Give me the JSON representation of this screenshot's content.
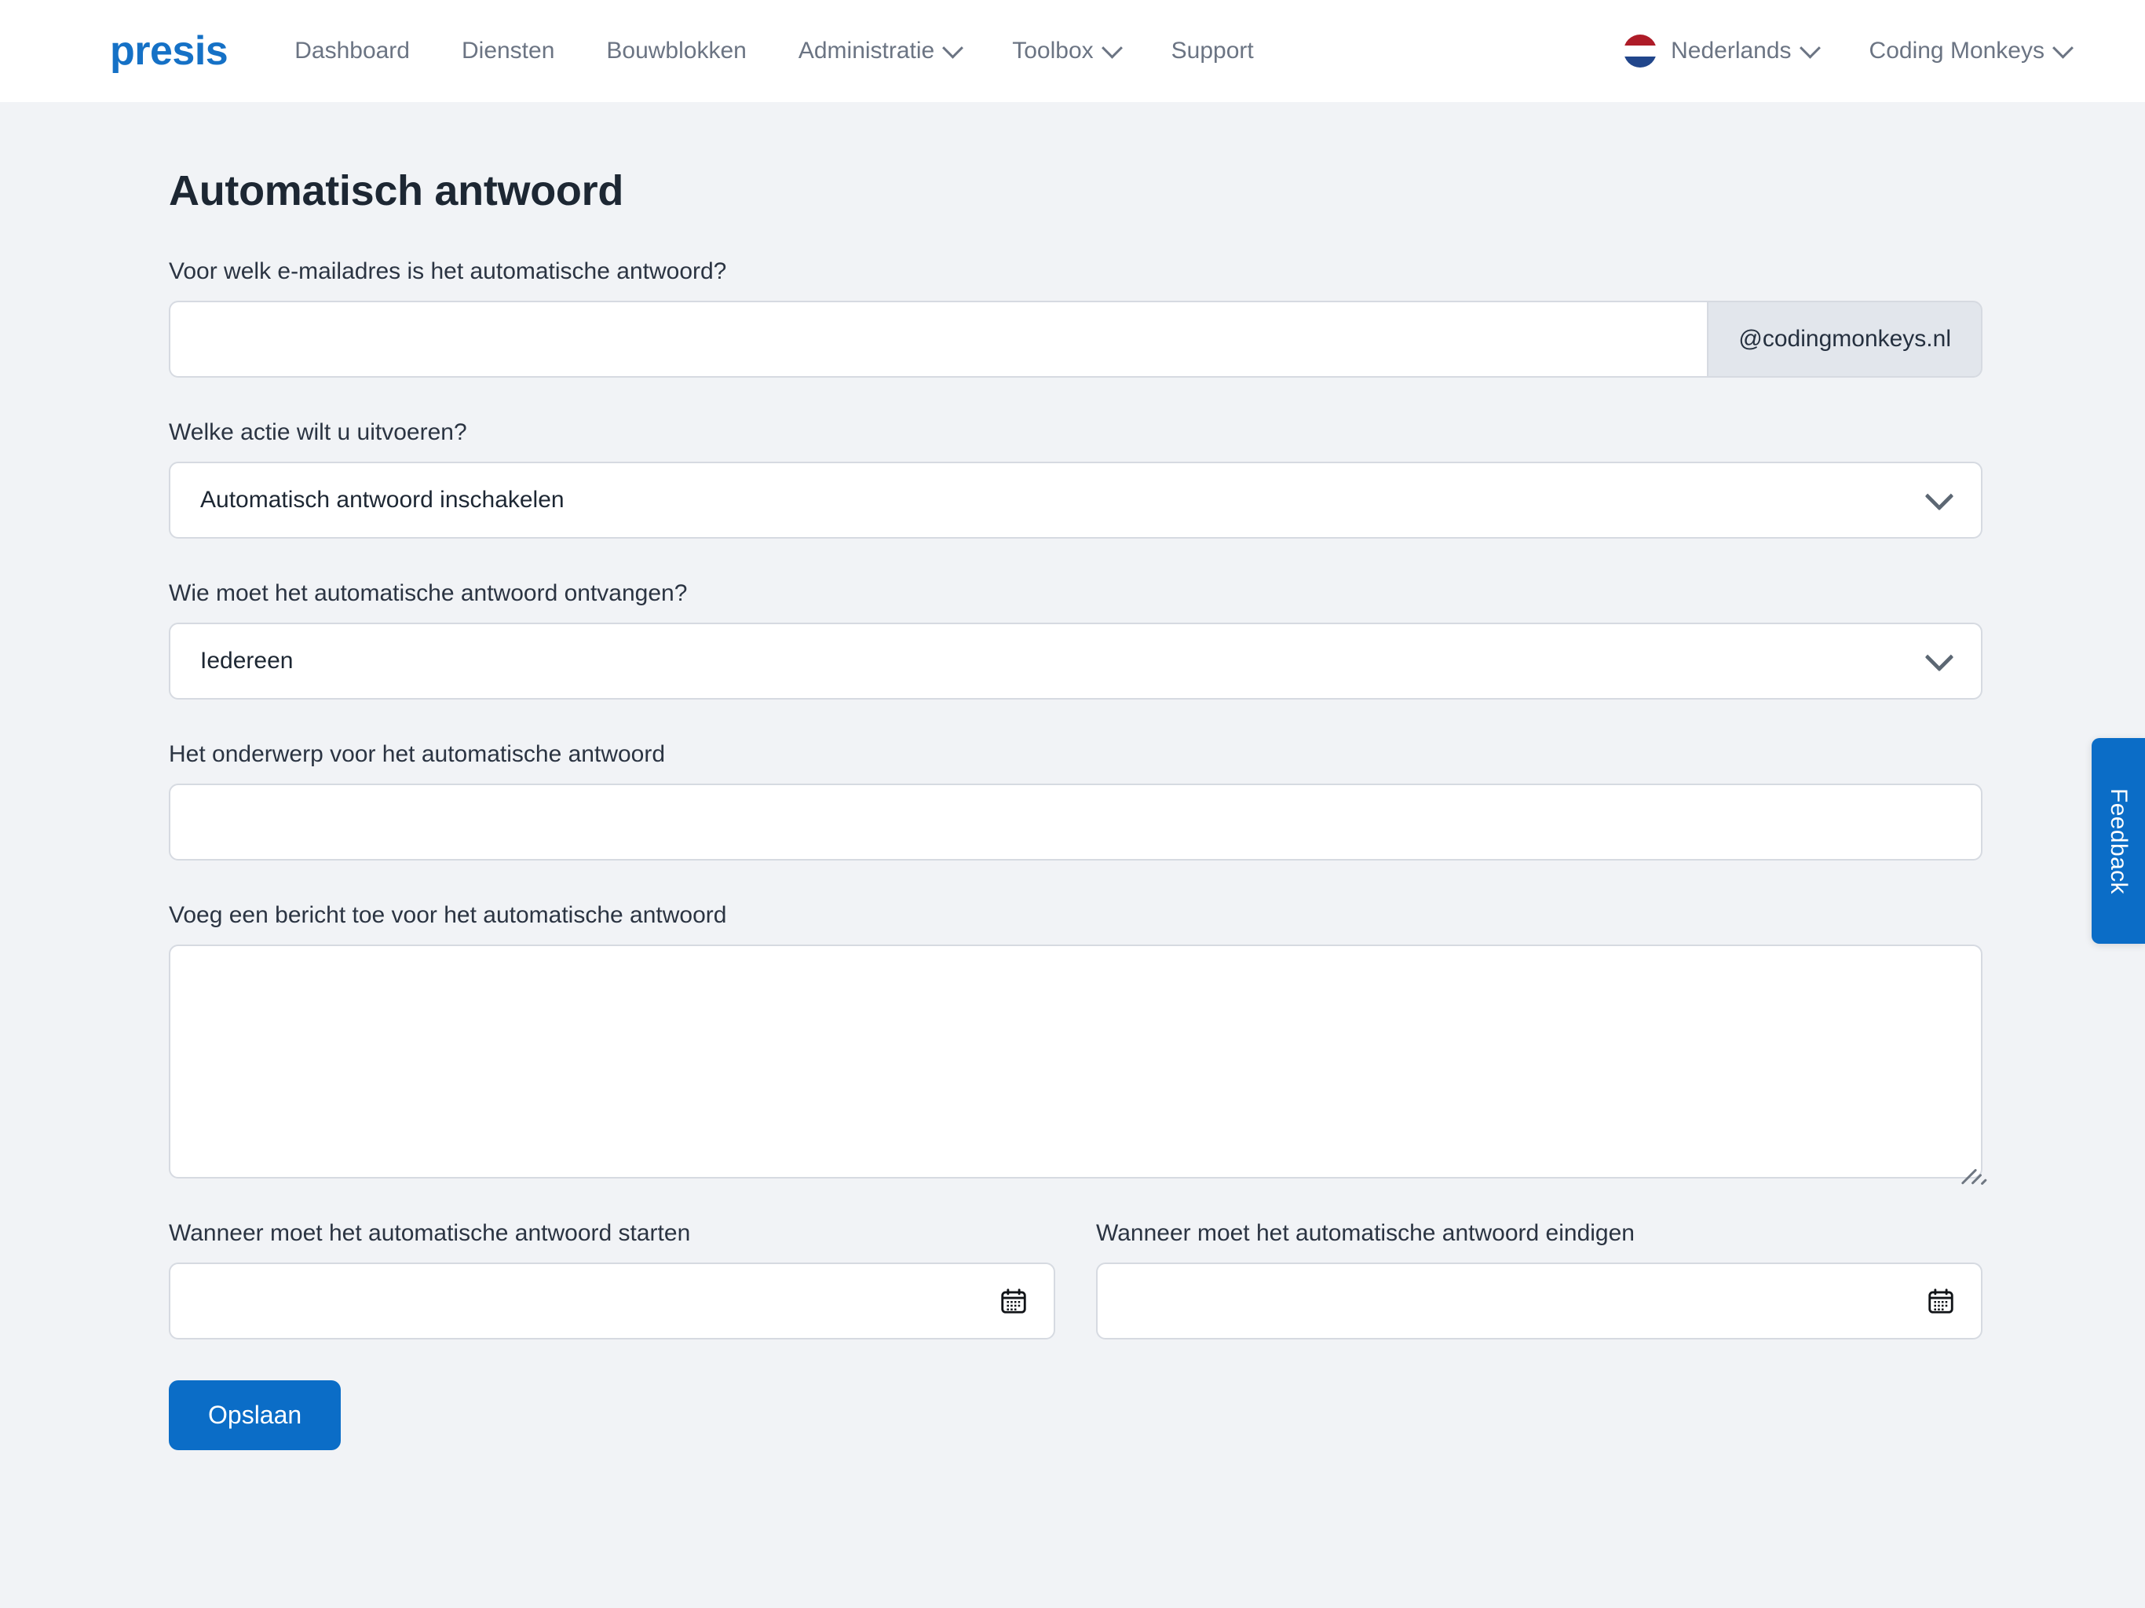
{
  "navbar": {
    "brand": "presis",
    "links": [
      {
        "label": "Dashboard",
        "has_dropdown": false
      },
      {
        "label": "Diensten",
        "has_dropdown": false
      },
      {
        "label": "Bouwblokken",
        "has_dropdown": false
      },
      {
        "label": "Administratie",
        "has_dropdown": true
      },
      {
        "label": "Toolbox",
        "has_dropdown": true
      },
      {
        "label": "Support",
        "has_dropdown": false
      }
    ],
    "language": {
      "label": "Nederlands",
      "flag": "dutch-flag-icon"
    },
    "account": {
      "label": "Coding Monkeys"
    }
  },
  "page": {
    "title": "Automatisch antwoord"
  },
  "form": {
    "email": {
      "label": "Voor welk e-mailadres is het automatische antwoord?",
      "value": "",
      "placeholder": "",
      "addon": "@codingmonkeys.nl"
    },
    "action": {
      "label": "Welke actie wilt u uitvoeren?",
      "value": "Automatisch antwoord inschakelen"
    },
    "recipient": {
      "label": "Wie moet het automatische antwoord ontvangen?",
      "value": "Iedereen"
    },
    "subject": {
      "label": "Het onderwerp voor het automatische antwoord",
      "value": "",
      "placeholder": ""
    },
    "message": {
      "label": "Voeg een bericht toe voor het automatische antwoord",
      "value": "",
      "placeholder": ""
    },
    "start_date": {
      "label": "Wanneer moet het automatische antwoord starten",
      "value": "",
      "placeholder": "",
      "icon": "calendar-icon"
    },
    "end_date": {
      "label": "Wanneer moet het automatische antwoord eindigen",
      "value": "",
      "placeholder": "",
      "icon": "calendar-icon"
    },
    "submit_label": "Opslaan"
  },
  "feedback": {
    "label": "Feedback"
  },
  "colors": {
    "brand_blue": "#1571c6",
    "primary": "#0b6dc7",
    "page_bg": "#f1f3f6",
    "navbar_bg": "#ffffff",
    "text": "#1d2733",
    "muted_text": "#6b7483",
    "border": "#d6dae1",
    "addon_bg": "#e2e6ec"
  }
}
